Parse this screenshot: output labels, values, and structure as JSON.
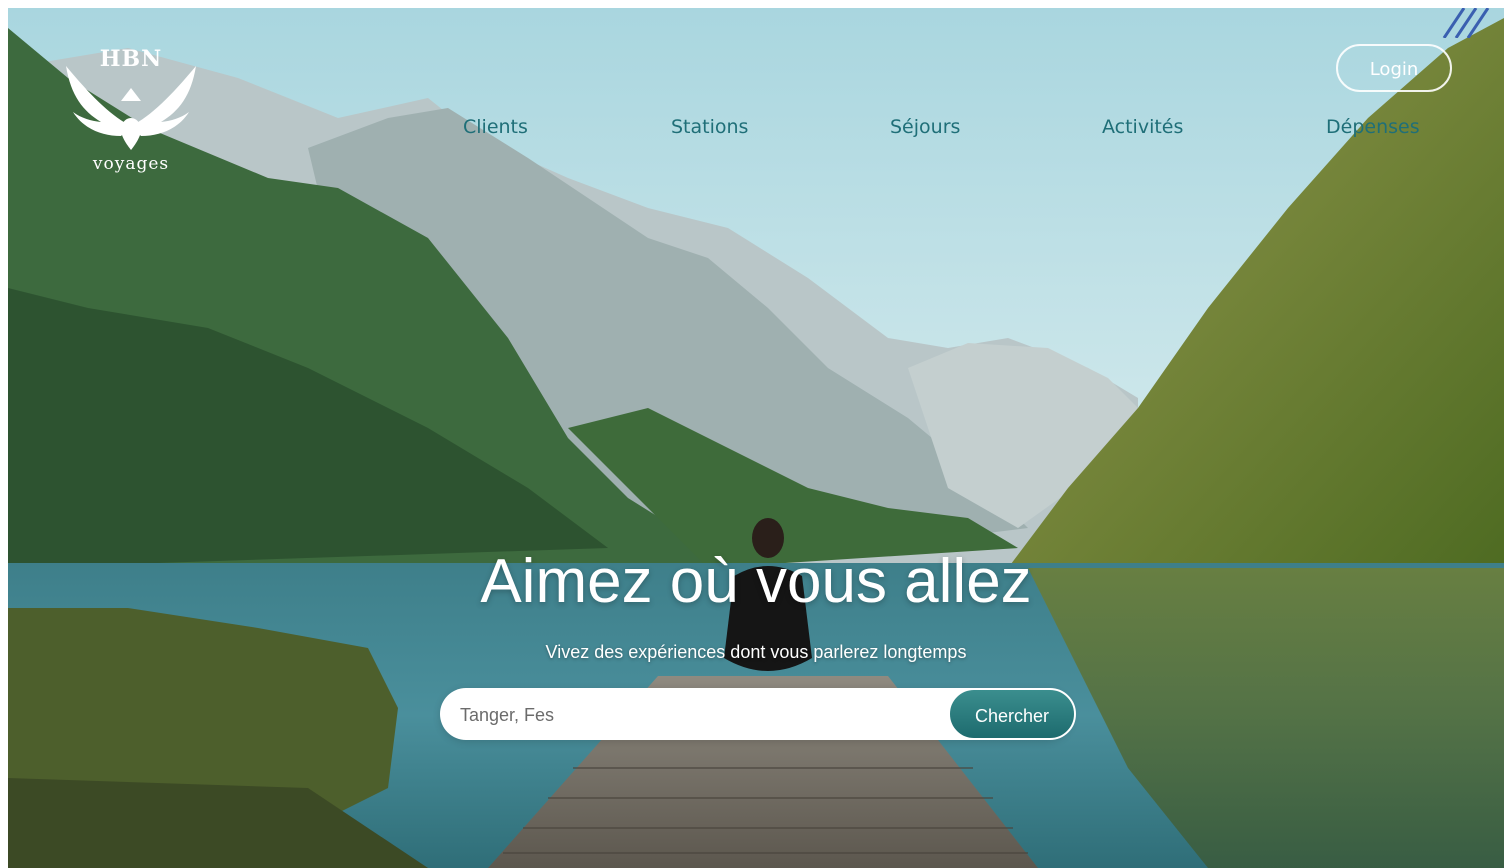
{
  "brand": {
    "title": "HBN",
    "subtitle": "voyages"
  },
  "nav": [
    {
      "label": "Clients"
    },
    {
      "label": "Stations"
    },
    {
      "label": "Séjours"
    },
    {
      "label": "Activités"
    },
    {
      "label": "Dépenses"
    }
  ],
  "login": {
    "label": "Login"
  },
  "hero": {
    "headline": "Aimez où vous allez",
    "subline": "Vivez des expériences dont vous parlerez longtemps"
  },
  "search": {
    "placeholder": "Tanger, Fes",
    "button_label": "Chercher"
  },
  "colors": {
    "accent": "#1f6f78",
    "button": "#2b7f80"
  }
}
